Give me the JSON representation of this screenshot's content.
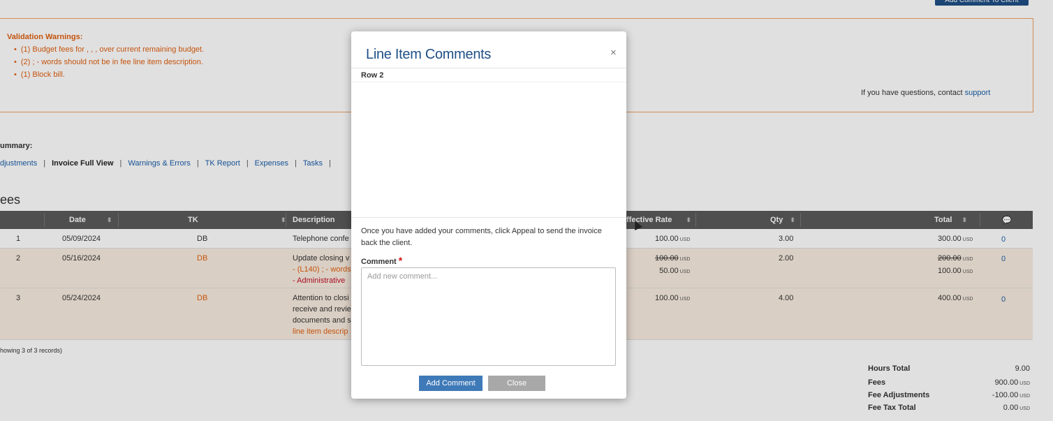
{
  "top_button": {
    "label": "Add Comment To Client"
  },
  "validation": {
    "title": "Validation Warnings:",
    "items": [
      "(1) Budget fees for , , , over current remaining budget.",
      "(2) ; - words should not be in fee line item description.",
      "(1) Block bill."
    ],
    "contact_prefix": "If you have questions, contact",
    "contact_link": "support"
  },
  "summary": {
    "label": "ummary:",
    "links": [
      "djustments",
      "Invoice Full View",
      "Warnings & Errors",
      "TK Report",
      "Expenses",
      "Tasks"
    ]
  },
  "fees_heading": "ees",
  "table": {
    "columns": {
      "date": "Date",
      "tk": "TK",
      "description": "Description",
      "rate": "ffective Rate",
      "qty": "Qty",
      "total": "Total"
    },
    "rows": [
      {
        "num": "1",
        "date": "05/09/2024",
        "tk": "DB",
        "desc": [
          "Telephone confe"
        ],
        "rate": "100.00",
        "qty": "3.00",
        "total": "300.00",
        "comments": "0"
      },
      {
        "num": "2",
        "date": "05/16/2024",
        "tk": "DB",
        "desc": [
          "Update closing v",
          "- (L140) ; - words",
          "- Administrative"
        ],
        "rate_old": "100.00",
        "rate_new": "50.00",
        "qty": "2.00",
        "total_old": "200.00",
        "total_new": "100.00",
        "comments": "0"
      },
      {
        "num": "3",
        "date": "05/24/2024",
        "tk": "DB",
        "desc": [
          "Attention to closi",
          "receive and revie",
          "documents and s",
          "line item descrip"
        ],
        "rate": "100.00",
        "qty": "4.00",
        "total": "400.00",
        "comments": "0"
      }
    ],
    "currency": "USD",
    "showing": "howing 3 of 3 records)"
  },
  "totals": [
    {
      "label": "Hours Total",
      "value": "9.00",
      "cur": ""
    },
    {
      "label": "Fees",
      "value": "900.00",
      "cur": "USD"
    },
    {
      "label": "Fee Adjustments",
      "value": "-100.00",
      "cur": "USD"
    },
    {
      "label": "Fee Tax Total",
      "value": "0.00",
      "cur": "USD"
    }
  ],
  "modal": {
    "title": "Line Item Comments",
    "close_symbol": "×",
    "row_label": "Row 2",
    "info": "Once you have added your comments, click Appeal to send the invoice back the client.",
    "comment_label": "Comment",
    "required_mark": "*",
    "placeholder": "Add new comment...",
    "add_button": "Add Comment",
    "close_button": "Close"
  }
}
